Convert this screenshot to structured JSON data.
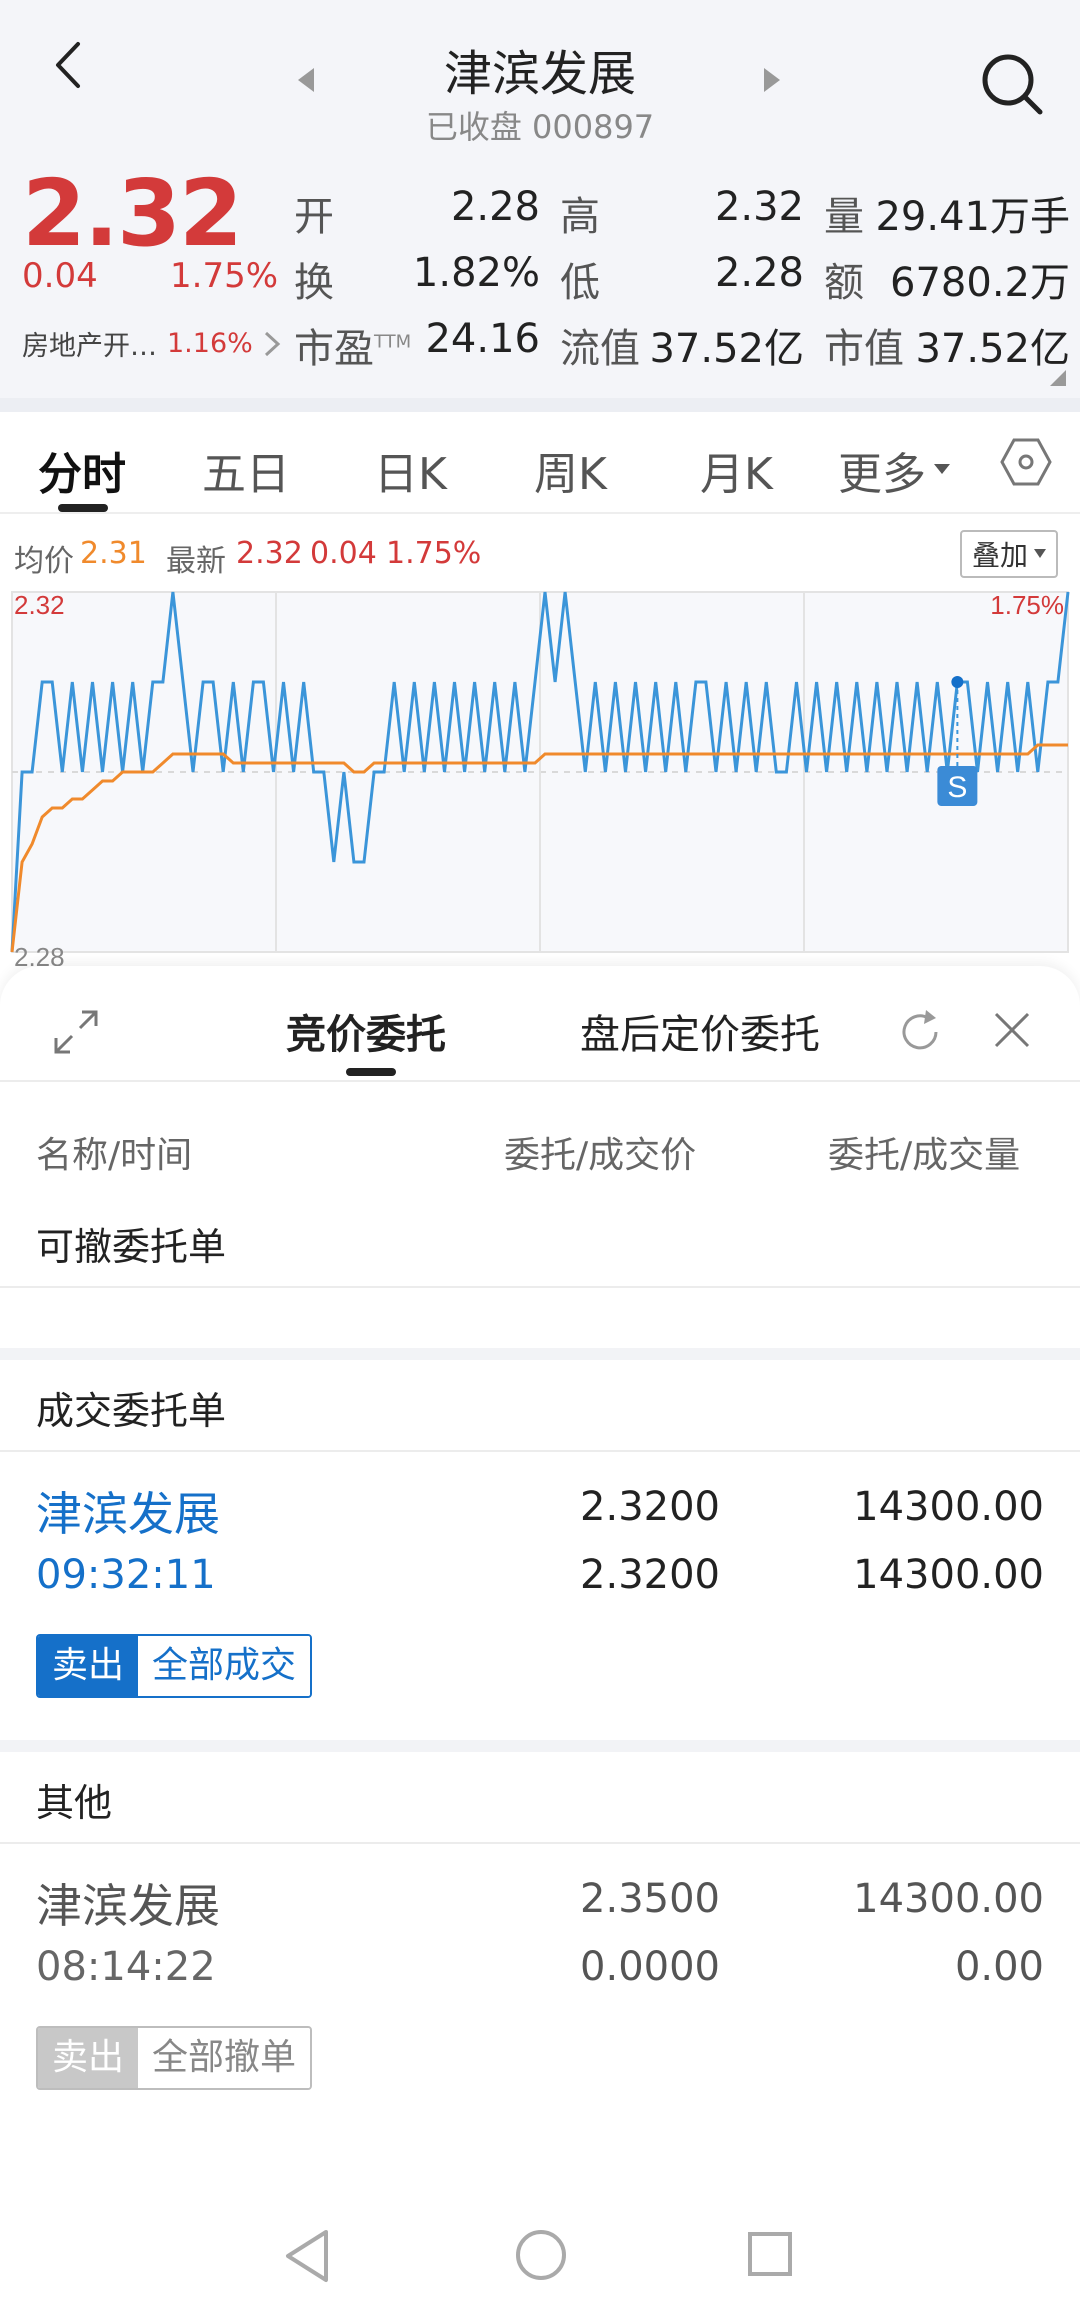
{
  "header": {
    "title": "津滨发展",
    "subtitle": "已收盘 000897"
  },
  "quote": {
    "price": "2.32",
    "change": "0.04",
    "change_pct": "1.75%",
    "sector_name": "房地产开…",
    "sector_pct": "1.16%",
    "rows": [
      {
        "l1": "开",
        "v1": "2.28",
        "l2": "高",
        "v2": "2.32",
        "l3": "量",
        "v3": "29.41万手"
      },
      {
        "l1": "换",
        "v1": "1.82%",
        "l2": "低",
        "v2": "2.28",
        "l3": "额",
        "v3": "6780.2万"
      },
      {
        "l1": "市盈",
        "l1_sup": "TTM",
        "v1": "24.16",
        "l2": "流值",
        "v2": "37.52亿",
        "l3": "市值",
        "v3": "37.52亿"
      }
    ]
  },
  "tabs": [
    "分时",
    "五日",
    "日K",
    "周K",
    "月K",
    "更多"
  ],
  "legend": {
    "avg_label": "均价",
    "avg_value": "2.31",
    "latest_label": "最新",
    "latest_value": "2.32",
    "latest_change": "0.04",
    "latest_pct": "1.75%",
    "overlay_button": "叠加"
  },
  "chart_data": {
    "type": "line",
    "ylim": [
      2.28,
      2.32
    ],
    "y_labels": {
      "top": "2.32",
      "bottom": "2.28",
      "top_right": "1.75%"
    },
    "marker_label": "S",
    "series": [
      {
        "values": [
          2.28,
          2.3,
          2.3,
          2.31,
          2.31,
          2.3,
          2.31,
          2.3,
          2.31,
          2.3,
          2.31,
          2.3,
          2.31,
          2.3,
          2.31,
          2.31,
          2.32,
          2.31,
          2.3,
          2.31,
          2.31,
          2.3,
          2.31,
          2.3,
          2.31,
          2.31,
          2.3,
          2.31,
          2.3,
          2.31,
          2.3,
          2.3,
          2.29,
          2.3,
          2.29,
          2.29,
          2.3,
          2.3,
          2.31,
          2.3,
          2.31,
          2.3,
          2.31,
          2.3,
          2.31,
          2.3,
          2.31,
          2.3,
          2.31,
          2.3,
          2.31,
          2.3,
          2.31,
          2.32,
          2.31,
          2.32,
          2.31,
          2.3,
          2.31,
          2.3,
          2.31,
          2.3,
          2.31,
          2.3,
          2.31,
          2.3,
          2.31,
          2.3,
          2.31,
          2.31,
          2.3,
          2.31,
          2.3,
          2.31,
          2.3,
          2.31,
          2.3,
          2.3,
          2.31,
          2.3,
          2.31,
          2.3,
          2.31,
          2.3,
          2.31,
          2.3,
          2.31,
          2.3,
          2.31,
          2.3,
          2.31,
          2.3,
          2.31,
          2.3,
          2.31,
          2.31,
          2.3,
          2.31,
          2.3,
          2.31,
          2.3,
          2.31,
          2.3,
          2.31,
          2.31,
          2.32
        ]
      },
      {
        "values": [
          2.28,
          2.29,
          2.292,
          2.295,
          2.296,
          2.296,
          2.297,
          2.297,
          2.298,
          2.299,
          2.299,
          2.3,
          2.3,
          2.3,
          2.3,
          2.301,
          2.302,
          2.302,
          2.302,
          2.302,
          2.302,
          2.302,
          2.301,
          2.301,
          2.301,
          2.301,
          2.301,
          2.301,
          2.301,
          2.301,
          2.301,
          2.301,
          2.301,
          2.301,
          2.3,
          2.3,
          2.301,
          2.301,
          2.301,
          2.301,
          2.301,
          2.301,
          2.301,
          2.301,
          2.301,
          2.301,
          2.301,
          2.301,
          2.301,
          2.301,
          2.301,
          2.301,
          2.301,
          2.302,
          2.302,
          2.302,
          2.302,
          2.302,
          2.302,
          2.302,
          2.302,
          2.302,
          2.302,
          2.302,
          2.302,
          2.302,
          2.302,
          2.302,
          2.302,
          2.302,
          2.302,
          2.302,
          2.302,
          2.302,
          2.302,
          2.302,
          2.302,
          2.302,
          2.302,
          2.302,
          2.302,
          2.302,
          2.302,
          2.302,
          2.302,
          2.302,
          2.302,
          2.302,
          2.302,
          2.302,
          2.302,
          2.302,
          2.302,
          2.302,
          2.302,
          2.302,
          2.302,
          2.302,
          2.302,
          2.302,
          2.302,
          2.302,
          2.303,
          2.303,
          2.303,
          2.303
        ]
      }
    ],
    "colors": {
      "price": "#3b95d9",
      "avg": "#f08a2c"
    }
  },
  "sheet": {
    "tabs": [
      "竞价委托",
      "盘后定价委托"
    ],
    "columns": [
      "名称/时间",
      "委托/成交价",
      "委托/成交量"
    ],
    "section_cancelable": "可撤委托单",
    "section_filled": "成交委托单",
    "section_other": "其他",
    "filled_order": {
      "name": "津滨发展",
      "time": "09:32:11",
      "price1": "2.3200",
      "price2": "2.3200",
      "qty1": "14300.00",
      "qty2": "14300.00",
      "side": "卖出",
      "status": "全部成交"
    },
    "other_order": {
      "name": "津滨发展",
      "time": "08:14:22",
      "price1": "2.3500",
      "price2": "0.0000",
      "qty1": "14300.00",
      "qty2": "0.00",
      "side": "卖出",
      "status": "全部撤单"
    }
  },
  "icons": [
    "back-icon",
    "prev-stock-icon",
    "next-stock-icon",
    "search-icon",
    "expand-icon",
    "settings-hexagon-icon",
    "refresh-icon",
    "close-icon",
    "nav-back-icon",
    "nav-home-icon",
    "nav-recents-icon"
  ],
  "colors": {
    "up_red": "#d33a3a",
    "blue": "#1570c9",
    "orange": "#f08a2c"
  }
}
